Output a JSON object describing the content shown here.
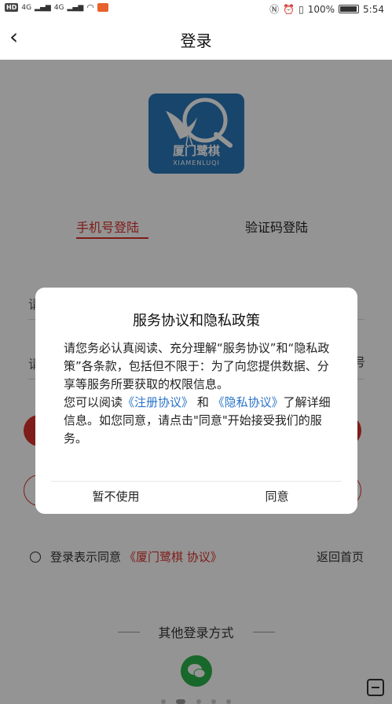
{
  "status_bar": {
    "hd": "HD",
    "signal1": "4G",
    "signal2": "4G",
    "battery": "100%",
    "time": "5:54"
  },
  "nav": {
    "back_icon": "chevron-left-icon",
    "title": "登录"
  },
  "logo": {
    "name_cn": "厦门鹭棋",
    "name_en": "XIAMENLUQI"
  },
  "tabs": [
    {
      "label": "手机号登陆",
      "active": true
    },
    {
      "label": "验证码登陆",
      "active": false
    }
  ],
  "form": {
    "phone_hint": "请",
    "code_hint": "请",
    "get_code": "号"
  },
  "agreement": {
    "prefix": "登录表示同意",
    "link": "《厦门鹭棋 协议》",
    "home": "返回首页"
  },
  "other_login": {
    "label": "其他登录方式"
  },
  "dialog": {
    "title": "服务协议和隐私政策",
    "para1": "请您务必认真阅读、充分理解“服务协议”和“隐私政策”各条款，包括但不限于：为了向您提供数据、分享等服务所要获取的权限信息。",
    "para2_prefix": "您可以阅读",
    "link_register": "《注册协议》",
    "and": "和",
    "link_privacy": "《隐私协议》",
    "para2_suffix": "了解详细信息。如您同意，请点击\"同意\"开始接受我们的服务。",
    "cancel": "暂不使用",
    "agree": "同意"
  },
  "colors": {
    "accent": "#d9332b",
    "link": "#2a73c9",
    "logo_bg": "#2a78b8",
    "wechat": "#2ab24a"
  }
}
